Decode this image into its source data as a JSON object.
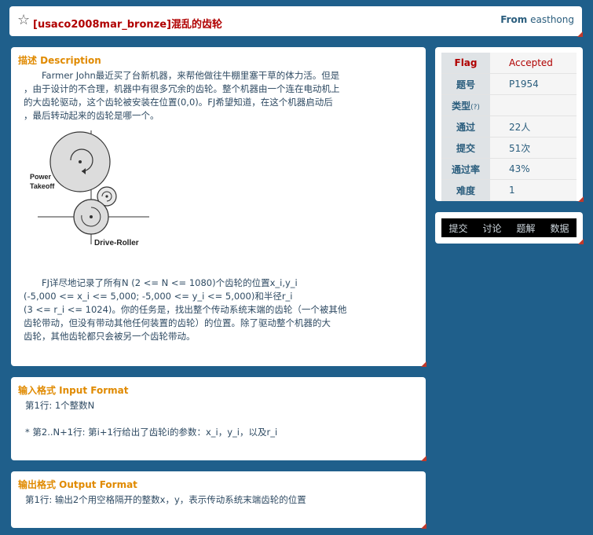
{
  "header": {
    "title": "[usaco2008mar_bronze]混乱的齿轮",
    "from_label": "From",
    "from_user": "easthong"
  },
  "description": {
    "title": "描述 Description",
    "para1": [
      "　　Farmer John最近买了台新机器，来帮他做往牛棚里塞干草的体力活。但是",
      "，由于设计的不合理，机器中有很多冗余的齿轮。整个机器由一个连在电动机上",
      "的大齿轮驱动，这个齿轮被安装在位置(0,0)。FJ希望知道，在这个机器启动后",
      "，最后转动起来的齿轮是哪一个。"
    ],
    "diagram": {
      "label_power": "Power",
      "label_takeoff": "Takeoff",
      "label_drive": "Drive-Roller"
    },
    "para2": [
      "　　FJ详尽地记录了所有N (2 <= N <= 1080)个齿轮的位置x_i,y_i",
      "(-5,000 <= x_i <= 5,000; -5,000 <= y_i <= 5,000)和半径r_i",
      "(3 <= r_i <= 1024)。你的任务是，找出整个传动系统末端的齿轮（一个被其他",
      "齿轮带动，但没有带动其他任何装置的齿轮）的位置。除了驱动整个机器的大",
      "齿轮，其他齿轮都只会被另一个齿轮带动。"
    ]
  },
  "input_format": {
    "title": "输入格式 Input Format",
    "line1": "第1行: 1个整数N",
    "line2": "* 第2..N+1行: 第i+1行给出了齿轮i的参数：x_i，y_i，以及r_i"
  },
  "output_format": {
    "title": "输出格式 Output Format",
    "line1": "第1行: 输出2个用空格隔开的整数x，y，表示传动系统末端齿轮的位置"
  },
  "info": {
    "rows": [
      {
        "label": "Flag",
        "value": "Accepted"
      },
      {
        "label": "题号",
        "value": "P1954"
      },
      {
        "label": "类型",
        "help": "(?)",
        "value": ""
      },
      {
        "label": "通过",
        "value": "22人"
      },
      {
        "label": "提交",
        "value": "51次"
      },
      {
        "label": "通过率",
        "value": "43%"
      },
      {
        "label": "难度",
        "value": "1"
      }
    ]
  },
  "nav": {
    "submit": "提交",
    "discuss": "讨论",
    "solutions": "题解",
    "data": "数据"
  }
}
